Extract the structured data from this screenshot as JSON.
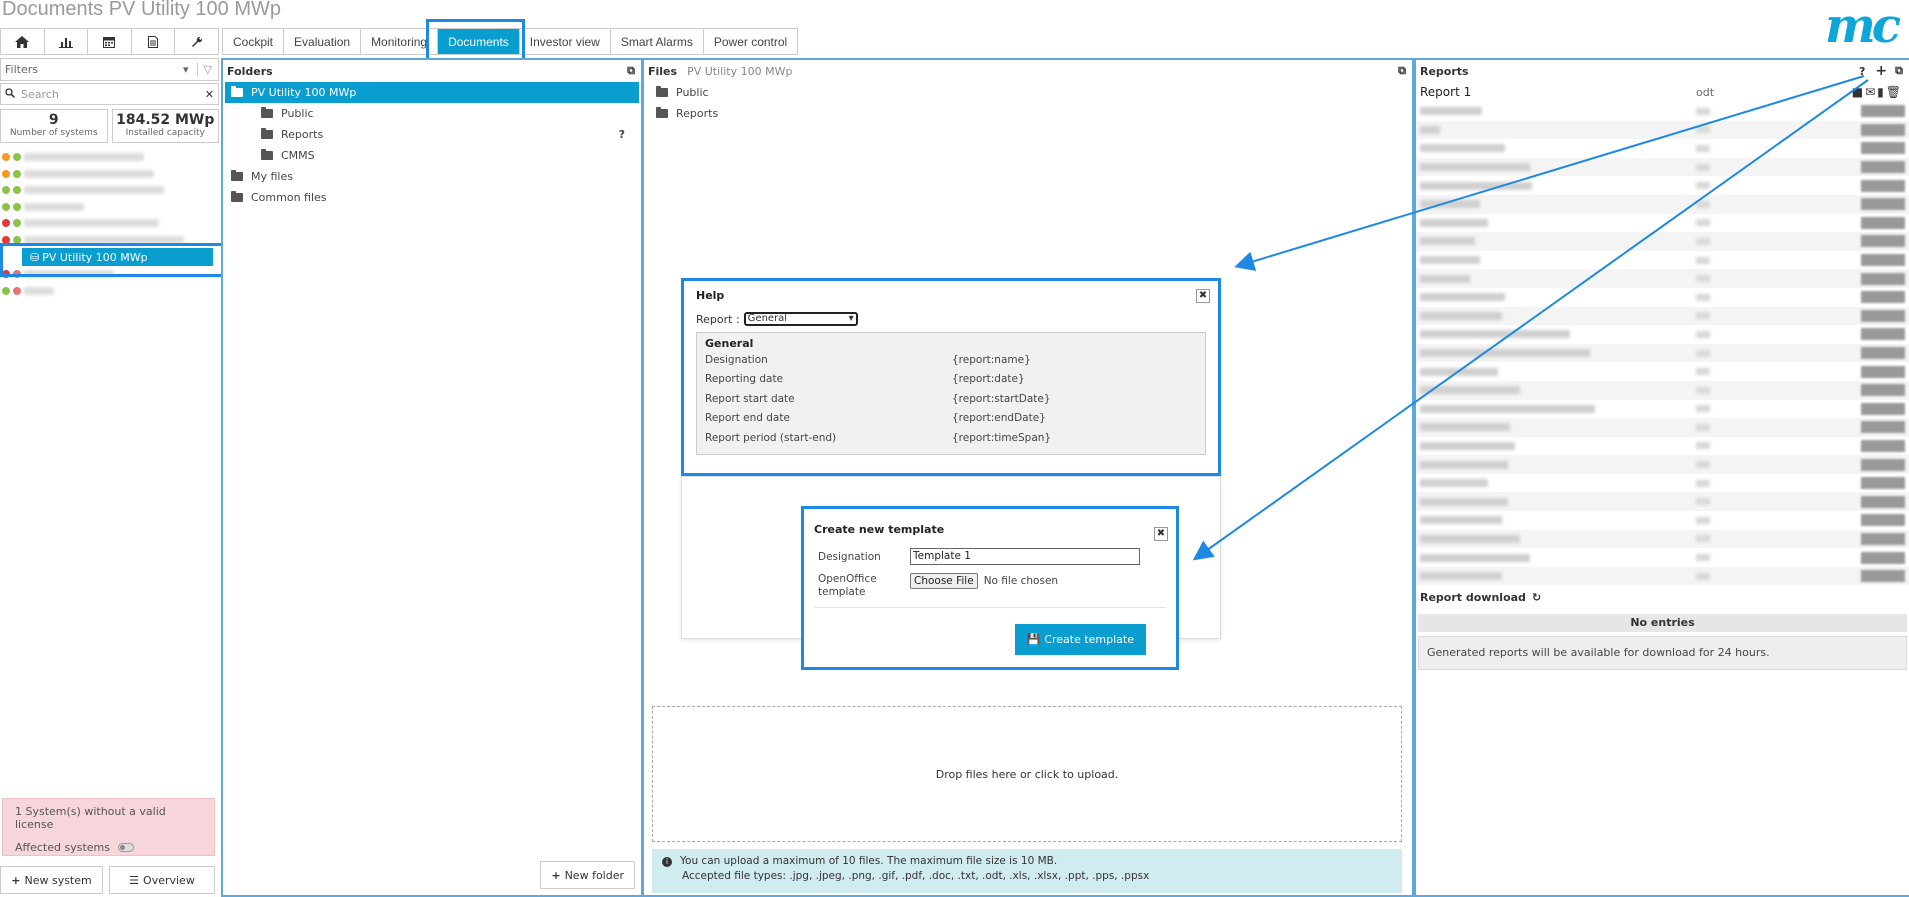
{
  "page": {
    "title": "Documents PV Utility 100 MWp",
    "logo": "mc"
  },
  "icon_bar": [
    "home-icon",
    "chart-icon",
    "calendar-icon",
    "document-icon",
    "wrench-icon"
  ],
  "tabs": [
    {
      "label": "Cockpit",
      "active": false
    },
    {
      "label": "Evaluation",
      "active": false
    },
    {
      "label": "Monitoring",
      "active": false
    },
    {
      "label": "Documents",
      "active": true
    },
    {
      "label": "Investor view",
      "active": false
    },
    {
      "label": "Smart Alarms",
      "active": false
    },
    {
      "label": "Power control",
      "active": false
    }
  ],
  "sidebar": {
    "filters_label": "Filters",
    "search_placeholder": "Search",
    "stats": [
      {
        "value": "9",
        "label": "Number of systems"
      },
      {
        "value": "184.52 MWp",
        "label": "Installed capacity"
      }
    ],
    "selected_system": "PV Utility 100 MWp",
    "license_text": "1 System(s) without a valid license",
    "affected_label": "Affected systems",
    "new_system_label": "New system",
    "overview_label": "Overview",
    "status_colors": {
      "orange": "#f59a1e",
      "green": "#8bc34a",
      "red": "#e53935"
    }
  },
  "folders": {
    "title": "Folders",
    "items": [
      {
        "label": "PV Utility 100 MWp",
        "selected": true,
        "level": 0
      },
      {
        "label": "Public",
        "level": 1
      },
      {
        "label": "Reports",
        "level": 1,
        "help": "?"
      },
      {
        "label": "CMMS",
        "level": 1
      },
      {
        "label": "My files",
        "level": 0
      },
      {
        "label": "Common files",
        "level": 0
      }
    ],
    "new_folder_label": "New folder"
  },
  "files": {
    "title": "Files",
    "subtitle": "PV Utility 100 MWp",
    "items": [
      "Public",
      "Reports"
    ],
    "drop_text": "Drop files here or click to upload.",
    "info_line1": "You can upload a maximum of 10 files. The maximum file size is 10 MB.",
    "info_line2": "Accepted file types: .jpg, .jpeg, .png, .gif, .pdf, .doc, .txt, .odt, .xls, .xlsx, .ppt, .pps, .ppsx"
  },
  "reports": {
    "title": "Reports",
    "first_name": "Report 1",
    "first_ext": "odt",
    "download_label": "Report download",
    "no_entries": "No entries",
    "generated_note": "Generated reports will be available for download for 24 hours."
  },
  "help_dialog": {
    "title": "Help",
    "report_label": "Report :",
    "report_value": "General",
    "group_label": "General",
    "rows": [
      {
        "key": "Designation",
        "value": "{report:name}"
      },
      {
        "key": "Reporting date",
        "value": "{report:date}"
      },
      {
        "key": "Report start date",
        "value": "{report:startDate}"
      },
      {
        "key": "Report end date",
        "value": "{report:endDate}"
      },
      {
        "key": "Report period (start-end)",
        "value": "{report:timeSpan}"
      }
    ]
  },
  "template_dialog": {
    "title": "Create new template",
    "designation_label": "Designation",
    "designation_value": "Template 1",
    "template_label": "OpenOffice template",
    "choose_file_label": "Choose File",
    "no_file_label": "No file chosen",
    "create_label": "Create template"
  },
  "colors": {
    "accent": "#0a9ed0",
    "highlight": "#1e88e5",
    "panel_border": "#5fa8dc"
  }
}
